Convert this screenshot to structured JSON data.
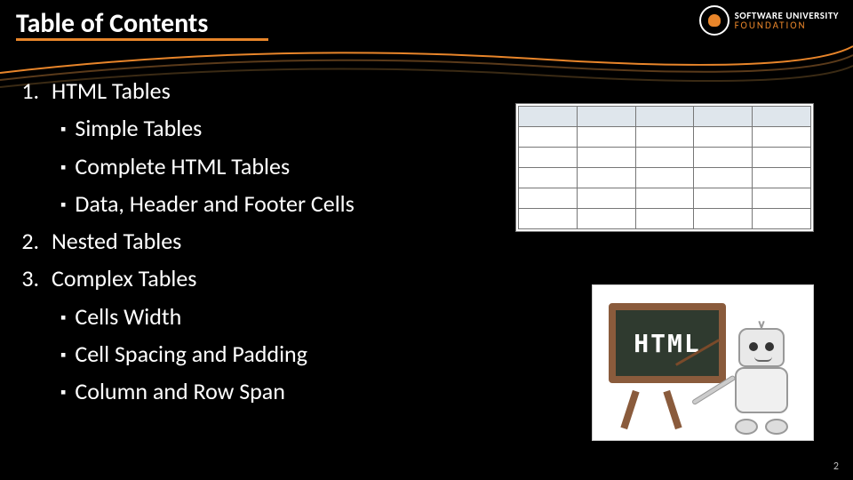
{
  "header": {
    "title": "Table of Contents"
  },
  "logo": {
    "line1": "SOFTWARE UNIVERSITY",
    "line2": "FOUNDATION"
  },
  "toc": {
    "item1": "HTML Tables",
    "item1_sub": {
      "a": "Simple Tables",
      "b": "Complete HTML Tables",
      "c": "Data, Header and Footer Cells"
    },
    "item2": "Nested Tables",
    "item3": "Complex Tables",
    "item3_sub": {
      "a": "Cells Width",
      "b": "Cell Spacing and Padding",
      "c": "Column and Row Span"
    }
  },
  "figures": {
    "board_text": "HTML",
    "table_grid": {
      "rows": 6,
      "cols": 5
    }
  },
  "page_number": "2"
}
